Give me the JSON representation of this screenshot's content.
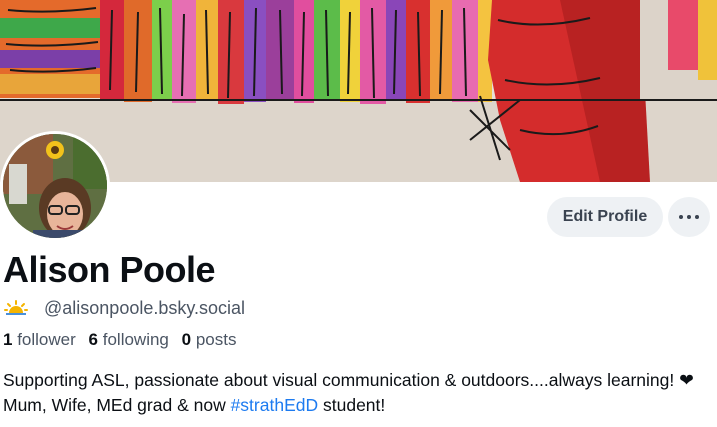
{
  "profile": {
    "display_name": "Alison Poole",
    "handle": "@alisonpoole.bsky.social",
    "handle_emoji_icon": "sunrise-icon",
    "followers_count": "1",
    "followers_label": "follower",
    "following_count": "6",
    "following_label": "following",
    "posts_count": "0",
    "posts_label": "posts",
    "bio_part1": "Supporting ASL, passionate about visual communication & outdoors....always learning! ",
    "bio_heart": "❤",
    "bio_part2": " Mum, Wife, MEd grad & now ",
    "bio_hashtag": "#strathEdD",
    "bio_part3": " student!"
  },
  "actions": {
    "edit_profile_label": "Edit Profile",
    "more_icon": "more-horizontal-icon"
  },
  "colors": {
    "accent": "#1d7bf0",
    "button_bg": "#eef1f4"
  }
}
